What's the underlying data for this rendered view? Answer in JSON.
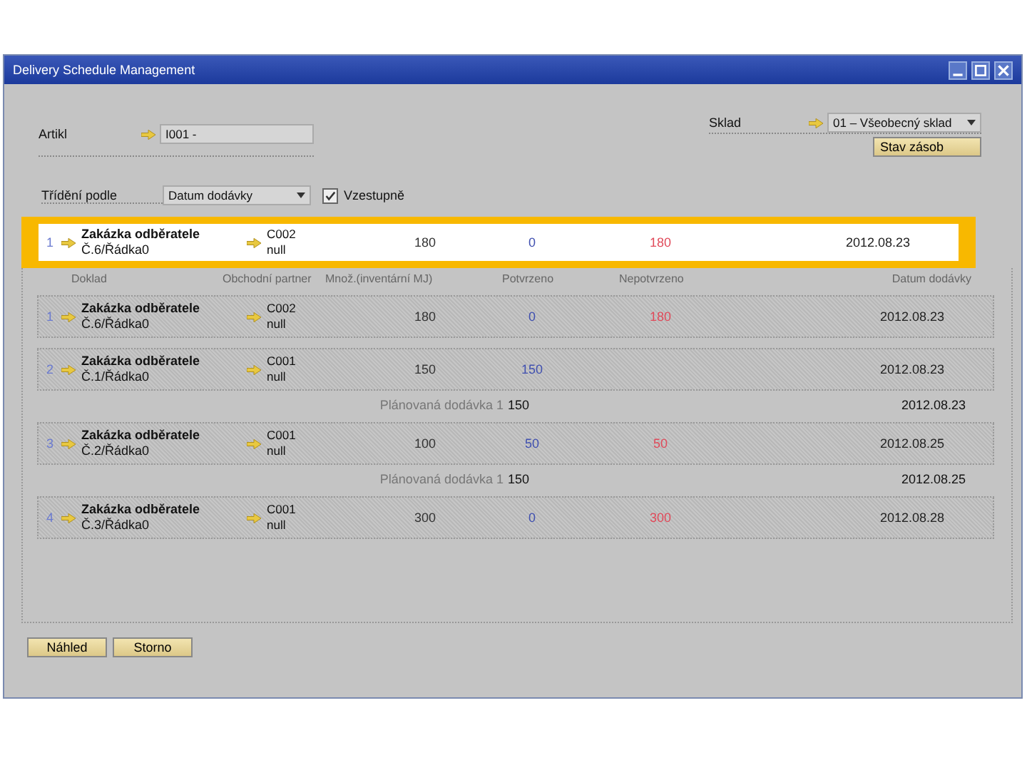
{
  "window": {
    "title": "Delivery Schedule Management"
  },
  "article": {
    "label": "Artikl",
    "value": "I001 -"
  },
  "warehouse": {
    "label": "Sklad",
    "value": "01 – Všeobecný sklad",
    "button": "Stav zásob"
  },
  "sort": {
    "label": "Třídění podle",
    "value": "Datum dodávky"
  },
  "ascending": {
    "label": "Vzestupně",
    "checked": true
  },
  "selected_row": {
    "number": "1",
    "document_type": "Zakázka odběratele",
    "document_number": "Č.6/Řádka0",
    "partner_code": "C002",
    "partner_name": "null",
    "quantity": "180",
    "confirmed": "0",
    "unconfirmed": "180",
    "date": "2012.08.23"
  },
  "columns": [
    "Doklad",
    "Obchodní partner",
    "Množ.(inventární MJ)",
    "Potvrzeno",
    "Nepotvrzeno",
    "Datum dodávky"
  ],
  "rows": [
    {
      "number": "1",
      "document_type": "Zakázka odběratele",
      "document_number": "Č.6/Řádka0",
      "partner_code": "C002",
      "partner_name": "null",
      "quantity": "180",
      "confirmed": "0",
      "unconfirmed": "180",
      "date": "2012.08.23"
    },
    {
      "number": "2",
      "document_type": "Zakázka odběratele",
      "document_number": "Č.1/Řádka0",
      "partner_code": "C001",
      "partner_name": "null",
      "quantity": "150",
      "confirmed": "150",
      "unconfirmed": "",
      "date": "2012.08.23",
      "planned_delivery": {
        "label": "Plánovaná dodávka 1",
        "quantity": "150",
        "date": "2012.08.23"
      }
    },
    {
      "number": "3",
      "document_type": "Zakázka odběratele",
      "document_number": "Č.2/Řádka0",
      "partner_code": "C001",
      "partner_name": "null",
      "quantity": "100",
      "confirmed": "50",
      "unconfirmed": "50",
      "date": "2012.08.25",
      "planned_delivery": {
        "label": "Plánovaná dodávka 1",
        "quantity": "150",
        "date": "2012.08.25"
      }
    },
    {
      "number": "4",
      "document_type": "Zakázka odběratele",
      "document_number": "Č.3/Řádka0",
      "partner_code": "C001",
      "partner_name": "null",
      "quantity": "300",
      "confirmed": "0",
      "unconfirmed": "300",
      "date": "2012.08.28"
    }
  ],
  "buttons": [
    "Náhled",
    "Storno"
  ]
}
